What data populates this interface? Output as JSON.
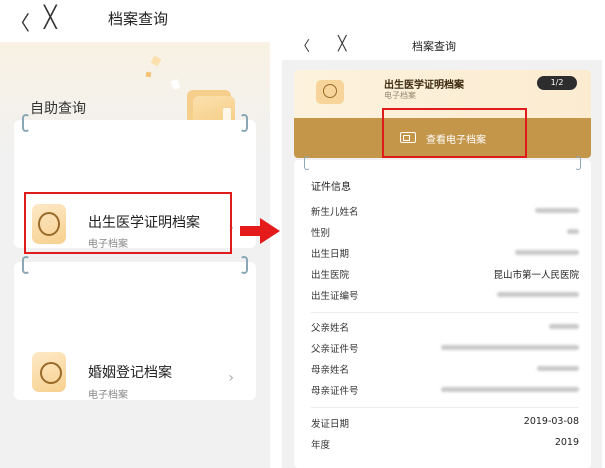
{
  "left": {
    "nav": {
      "back": "〈",
      "close": "╳",
      "title": "档案查询"
    },
    "self_service": "自助查询",
    "cards": [
      {
        "name": "出生医学证明档案",
        "sub": "电子档案",
        "chevron": "›"
      },
      {
        "name": "婚姻登记档案",
        "sub": "电子档案",
        "chevron": "›"
      }
    ]
  },
  "right": {
    "nav": {
      "back": "〈",
      "close": "╳",
      "title": "档案查询"
    },
    "header": {
      "name": "出生医学证明档案",
      "sub": "电子档案",
      "pager": "1/2",
      "view_button": "查看电子档案"
    },
    "info": {
      "title": "证件信息",
      "rows": [
        {
          "label": "新生儿姓名",
          "value": ""
        },
        {
          "label": "性别",
          "value": ""
        },
        {
          "label": "出生日期",
          "value": ""
        },
        {
          "label": "出生医院",
          "value": "昆山市第一人民医院"
        },
        {
          "label": "出生证编号",
          "value": ""
        },
        {
          "label": "父亲姓名",
          "value": ""
        },
        {
          "label": "父亲证件号",
          "value": ""
        },
        {
          "label": "母亲姓名",
          "value": ""
        },
        {
          "label": "母亲证件号",
          "value": ""
        },
        {
          "label": "发证日期",
          "value": "2019-03-08"
        },
        {
          "label": "年度",
          "value": "2019"
        }
      ]
    }
  },
  "colors": {
    "accent_gold": "#c4964a",
    "highlight_red": "#e01b1b",
    "arrow_red": "#e51b1b"
  }
}
